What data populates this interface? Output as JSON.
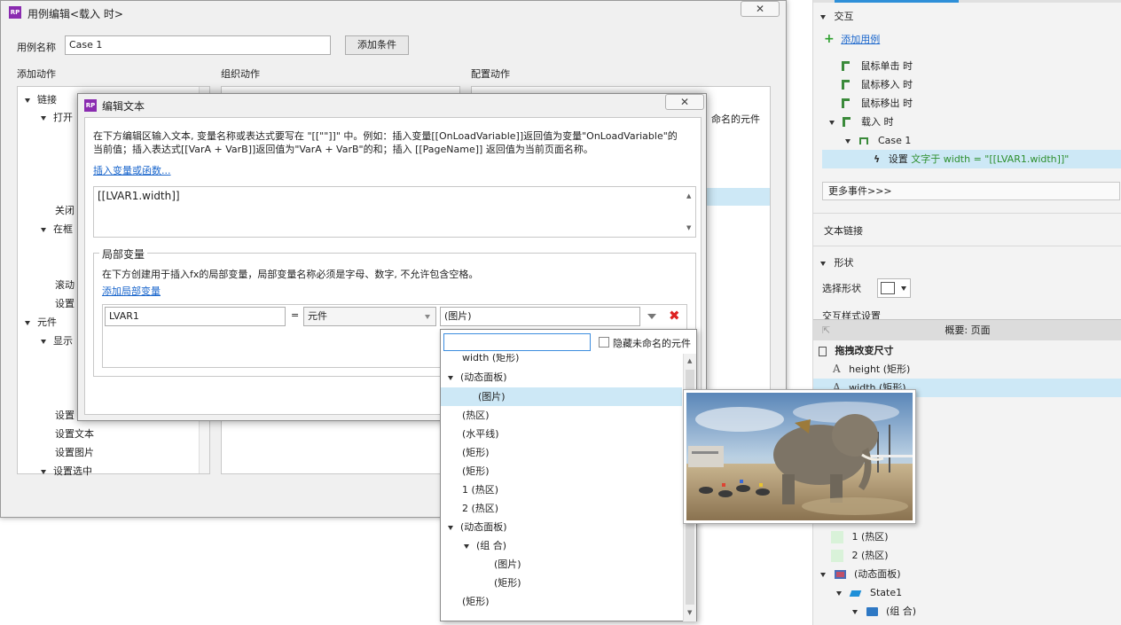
{
  "right_panel": {
    "interaction_header": "交互",
    "add_case": "添加用例",
    "events": [
      "鼠标单击 时",
      "鼠标移入 时",
      "鼠标移出 时",
      "载入 时"
    ],
    "case_name": "Case 1",
    "action_prefix": "设置",
    "action_text": "文字于 width = \"[[LVAR1.width]]\"",
    "more_events": "更多事件>>>",
    "text_link": "文本链接",
    "shape_header": "形状",
    "select_shape": "选择形状",
    "interaction_style": "交互样式设置",
    "outline_title": "概要: 页面",
    "outline_root": "拖拽改变尺寸",
    "outline_items": [
      "height (矩形)",
      "width (矩形)"
    ],
    "outline_lower": [
      "1 (热区)",
      "2 (热区)",
      "(动态面板)",
      "State1",
      "(组 合)"
    ]
  },
  "case_editor": {
    "title": "用例编辑<载入 时>",
    "close": "✕",
    "case_name_label": "用例名称",
    "case_name_value": "Case 1",
    "add_condition": "添加条件",
    "col_add_action": "添加动作",
    "col_organize": "组织动作",
    "col_configure": "配置动作",
    "actions_tree": [
      "链接",
      "打开",
      "关闭",
      "在框",
      "滚动",
      "设置",
      "元件",
      "显示",
      "设置",
      "设置文本",
      "设置图片",
      "设置选中"
    ],
    "partial_text": "命名的元件"
  },
  "edit_text": {
    "title": "编辑文本",
    "close": "✕",
    "desc_line1": "在下方编辑区输入文本, 变量名称或表达式要写在 \"[[\"\"]]\" 中。例如：插入变量[[OnLoadVariable]]返回值为变量\"OnLoadVariable\"的",
    "desc_line2": "当前值；插入表达式[[VarA + VarB]]返回值为\"VarA + VarB\"的和；插入 [[PageName]] 返回值为当前页面名称。",
    "insert_link": "插入变量或函数...",
    "editor_value": "[[LVAR1.width]]",
    "local_vars_title": "局部变量",
    "local_vars_desc": "在下方创建用于插入fx的局部变量，局部变量名称必须是字母、数字, 不允许包含空格。",
    "add_local_var": "添加局部变量",
    "var_name": "LVAR1",
    "equals": "=",
    "var_type": "元件",
    "var_target": "(图片)"
  },
  "dropdown": {
    "search_value": "",
    "hide_unnamed": "隐藏未命名的元件",
    "items": [
      "width (矩形)",
      "(动态面板)",
      "(图片)",
      "(热区)",
      "(水平线)",
      "(矩形)",
      "(矩形)",
      "1 (热区)",
      "2 (热区)",
      "(动态面板)",
      "(组 合)",
      "(图片)",
      "(矩形)",
      "(矩形)"
    ]
  }
}
